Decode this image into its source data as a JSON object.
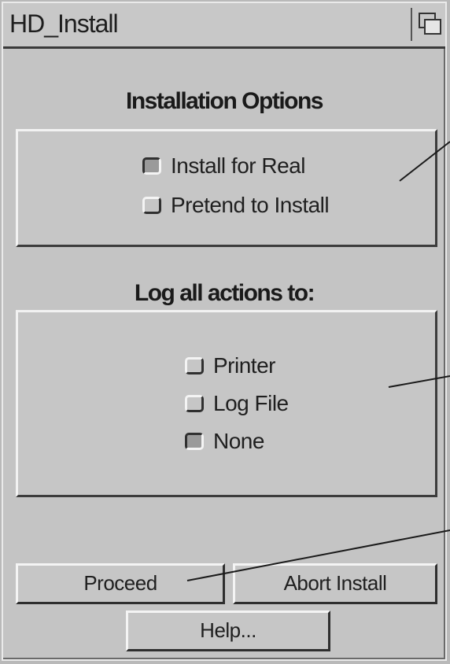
{
  "window": {
    "title": "HD_Install"
  },
  "installation_options": {
    "heading": "Installation Options",
    "options": [
      {
        "label": "Install for Real",
        "selected": true
      },
      {
        "label": "Pretend to Install",
        "selected": false
      }
    ]
  },
  "log_options": {
    "heading": "Log all actions to:",
    "options": [
      {
        "label": "Printer",
        "selected": false
      },
      {
        "label": "Log File",
        "selected": false
      },
      {
        "label": "None",
        "selected": true
      }
    ]
  },
  "buttons": {
    "proceed": "Proceed",
    "abort": "Abort Install",
    "help": "Help..."
  },
  "icons": {
    "window_depth": "depth-gadget-icon",
    "radio": "radio-button-icon"
  },
  "colors": {
    "window_bg": "#c4c4c4",
    "highlight": "#f2f2f2",
    "shadow": "#3c3c3c",
    "callout_line": "#1a1a1a"
  }
}
